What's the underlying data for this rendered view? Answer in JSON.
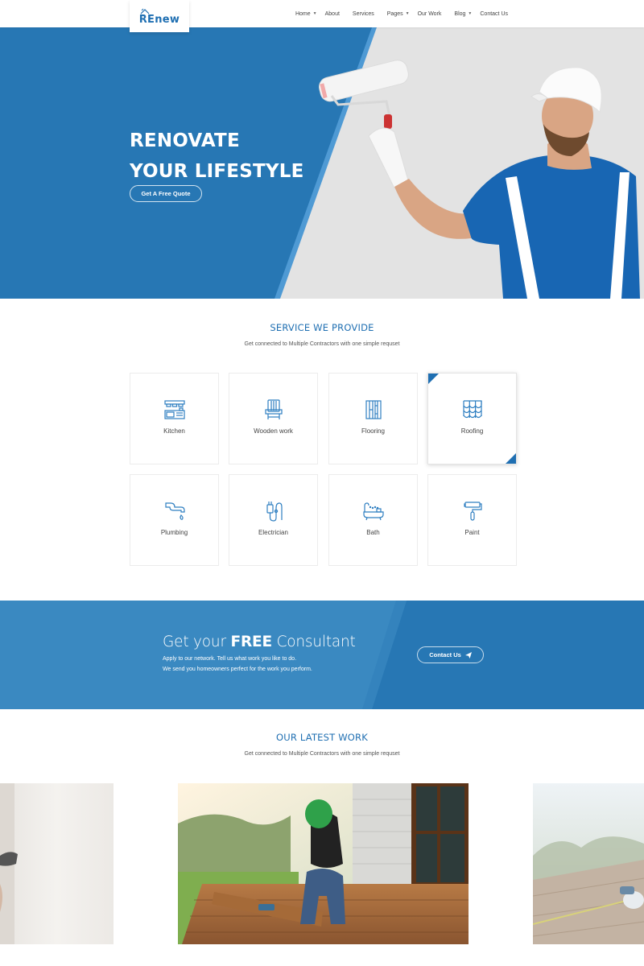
{
  "header": {
    "logo": "REnew",
    "nav": [
      {
        "label": "Home",
        "has_dropdown": true
      },
      {
        "label": "About",
        "has_dropdown": false
      },
      {
        "label": "Services",
        "has_dropdown": false
      },
      {
        "label": "Pages",
        "has_dropdown": true
      },
      {
        "label": "Our Work",
        "has_dropdown": false
      },
      {
        "label": "Blog",
        "has_dropdown": true
      },
      {
        "label": "Contact Us",
        "has_dropdown": false
      }
    ]
  },
  "hero": {
    "title_line1": "RENOVATE",
    "title_line2": "YOUR LIFESTYLE",
    "cta_label": "Get A Free Quote"
  },
  "services": {
    "title": "SERVICE WE PROVIDE",
    "subtitle": "Get connected to Multiple Contractors with one simple requset",
    "items": [
      {
        "label": "Kitchen",
        "icon": "kitchen-icon"
      },
      {
        "label": "Wooden work",
        "icon": "chair-icon"
      },
      {
        "label": "Flooring",
        "icon": "flooring-icon"
      },
      {
        "label": "Roofing",
        "icon": "roof-tiles-icon",
        "active": true
      },
      {
        "label": "Plumbing",
        "icon": "faucet-icon"
      },
      {
        "label": "Electrician",
        "icon": "plug-icon"
      },
      {
        "label": "Bath",
        "icon": "bathtub-icon"
      },
      {
        "label": "Paint",
        "icon": "paint-roller-icon"
      }
    ]
  },
  "cta": {
    "title_pre": "Get your ",
    "title_bold": "FREE",
    "title_post": " Consultant",
    "line1": "Apply to our network. Tell us what work you like to do.",
    "line2": "We send you homeowners perfect for the work you perform.",
    "button_label": "Contact Us",
    "button_icon": "paper-plane-icon"
  },
  "work": {
    "title": "OUR LATEST WORK",
    "subtitle": "Get connected to Multiple Contractors with one simple requset"
  },
  "colors": {
    "brand_blue": "#1f6fb2",
    "hero_blue": "#2777b4",
    "hero_bg_gray": "#e3e3e3"
  }
}
